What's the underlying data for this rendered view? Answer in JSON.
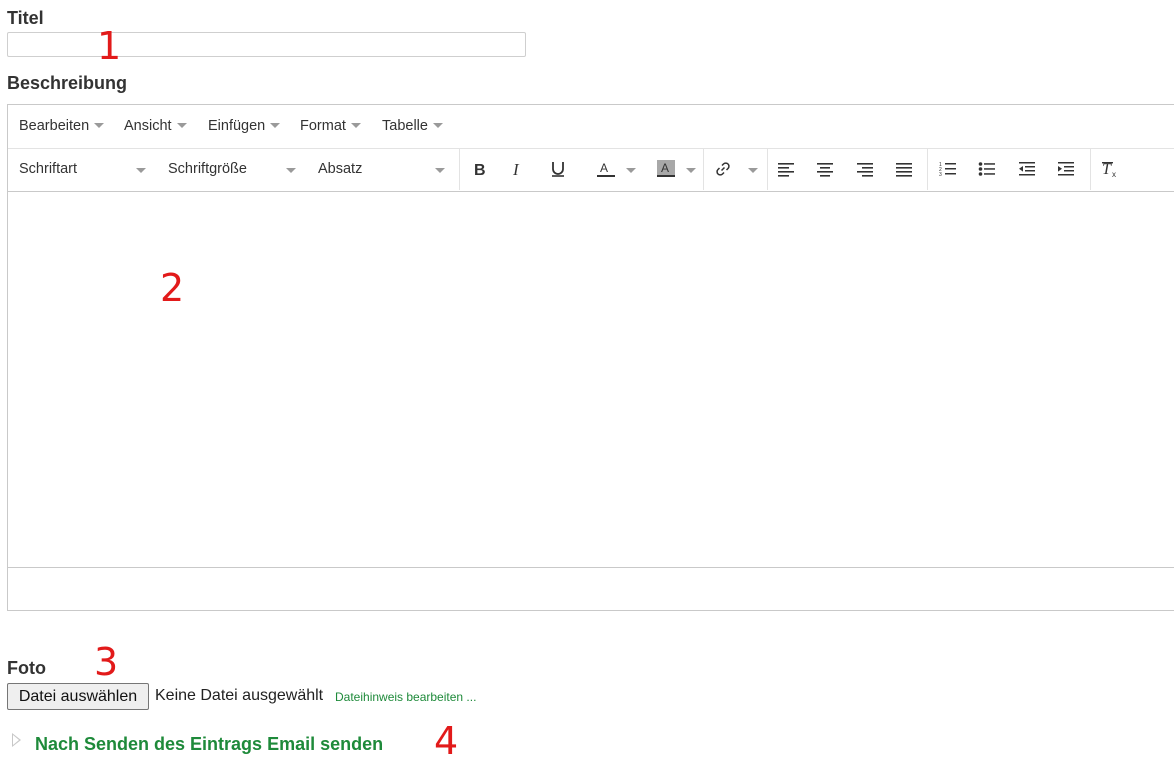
{
  "form": {
    "title_label": "Titel",
    "title_value": "",
    "description_label": "Beschreibung",
    "photo_label": "Foto",
    "file_button": "Datei auswählen",
    "no_file_text": "Keine Datei ausgewählt",
    "file_hint_link": "Dateihinweis bearbeiten ...",
    "email_toggle": "Nach Senden des Eintrags Email senden"
  },
  "editor": {
    "menu": [
      "Bearbeiten",
      "Ansicht",
      "Einfügen",
      "Format",
      "Tabelle"
    ],
    "font_family": "Schriftart",
    "font_size": "Schriftgröße",
    "block_format": "Absatz",
    "icons": [
      "bold-icon",
      "italic-icon",
      "underline-icon",
      "text-color-icon",
      "background-color-icon",
      "link-icon",
      "align-left-icon",
      "align-center-icon",
      "align-right-icon",
      "align-justify-icon",
      "numbered-list-icon",
      "bullet-list-icon",
      "outdent-icon",
      "indent-icon",
      "clear-formatting-icon"
    ],
    "content": ""
  },
  "annotations": [
    "1",
    "2",
    "3",
    "4"
  ],
  "colors": {
    "accent": "#1e8a3a",
    "annotation": "#e21a1a",
    "border": "#c9c9c9"
  }
}
